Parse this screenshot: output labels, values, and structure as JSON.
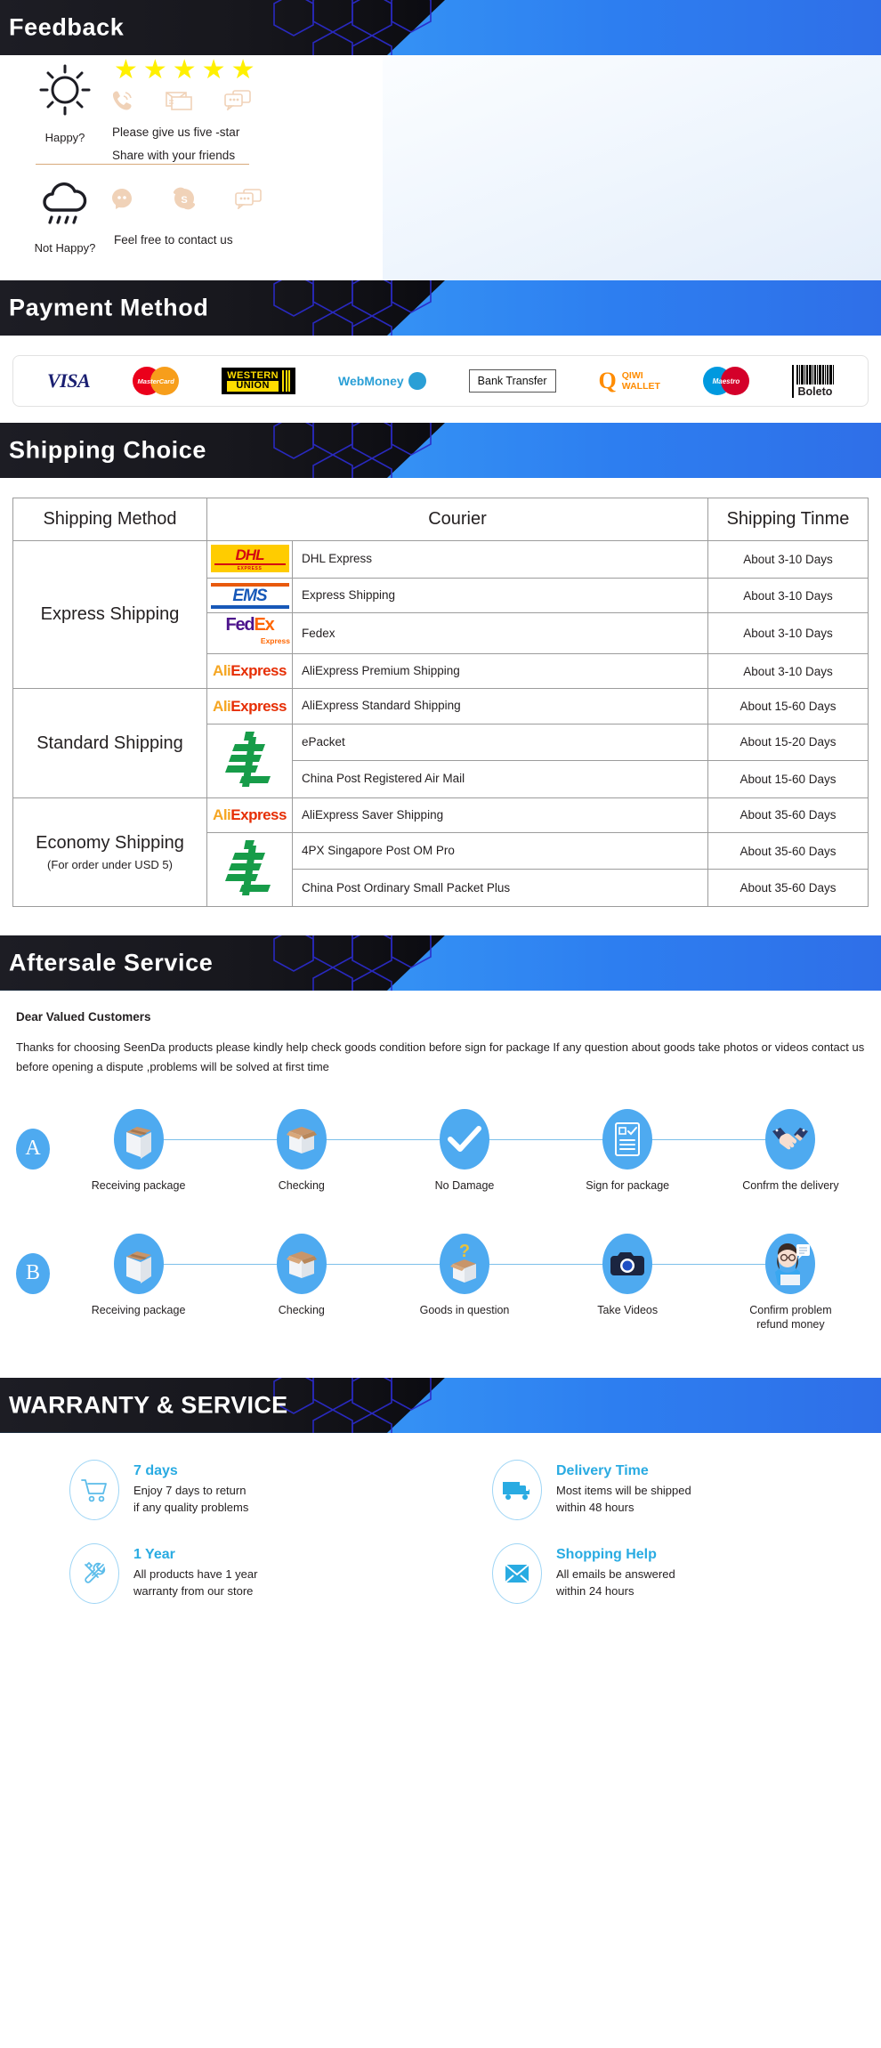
{
  "colors": {
    "accent_blue": "#29abe2",
    "banner_blue": "#2d7ef0",
    "banner_dark": "#17171d",
    "star_yellow": "#fff000",
    "flow_circle": "#4eaaf0",
    "divider_tan": "#d8a97a"
  },
  "feedback": {
    "banner_title": "Feedback",
    "happy_label": "Happy?",
    "stars": "★★★★★",
    "star_count": 5,
    "happy_line1": "Please give us five -star",
    "happy_line2": "Share  with your friends",
    "not_happy_label": "Not Happy?",
    "not_happy_text": "Feel free to contact us",
    "contact_icons": [
      "phone-icon",
      "envelope-icon",
      "chat-icon"
    ],
    "contact_icons_row2": [
      "facebook-messenger-icon",
      "skype-icon",
      "chat-icon"
    ]
  },
  "payment": {
    "banner_title": "Payment Method",
    "methods": [
      {
        "name": "visa-logo",
        "label": "VISA"
      },
      {
        "name": "mastercard-logo",
        "label": "MasterCard"
      },
      {
        "name": "western-union-logo",
        "label_top": "WESTERN",
        "label_bottom": "UNION"
      },
      {
        "name": "webmoney-logo",
        "label": "WebMoney"
      },
      {
        "name": "bank-transfer-logo",
        "label": "Bank Transfer"
      },
      {
        "name": "qiwi-wallet-logo",
        "label_top": "QIWI",
        "label_bottom": "WALLET",
        "mark": "Q"
      },
      {
        "name": "maestro-logo",
        "label": "Maestro"
      },
      {
        "name": "boleto-logo",
        "label": "Boleto"
      }
    ]
  },
  "shipping": {
    "banner_title": "Shipping Choice",
    "columns": [
      "Shipping Method",
      "Courier",
      "Shipping Tinme"
    ],
    "groups": [
      {
        "method": "Express Shipping",
        "note": "",
        "rows": [
          {
            "logo": "dhl-logo",
            "courier": "DHL Express",
            "time": "About 3-10 Days"
          },
          {
            "logo": "ems-logo",
            "courier": "Express Shipping",
            "time": "About 3-10 Days"
          },
          {
            "logo": "fedex-logo",
            "courier": "Fedex",
            "time": "About 3-10 Days"
          },
          {
            "logo": "aliexpress-logo",
            "courier": "AliExpress Premium Shipping",
            "time": "About 3-10 Days"
          }
        ]
      },
      {
        "method": "Standard Shipping",
        "note": "",
        "rows": [
          {
            "logo": "aliexpress-logo",
            "courier": "AliExpress Standard Shipping",
            "time": "About 15-60 Days"
          },
          {
            "logo": "china-post-logo",
            "courier": "ePacket",
            "time": "About 15-20 Days",
            "logo_span": 2
          },
          {
            "logo": "",
            "courier": "China Post Registered Air Mail",
            "time": "About 15-60 Days"
          }
        ]
      },
      {
        "method": "Economy Shipping",
        "note": "(For order under USD 5)",
        "rows": [
          {
            "logo": "aliexpress-logo",
            "courier": "AliExpress Saver Shipping",
            "time": "About 35-60 Days"
          },
          {
            "logo": "china-post-logo",
            "courier": "4PX Singapore Post OM Pro",
            "time": "About 35-60 Days",
            "logo_span": 2
          },
          {
            "logo": "",
            "courier": "China Post Ordinary Small Packet Plus",
            "time": "About 35-60 Days"
          }
        ]
      }
    ],
    "logo_text": {
      "dhl": "DHL",
      "dhl_sub": "EXPRESS",
      "ems": "EMS",
      "fedex_fed": "Fed",
      "fedex_ex": "Ex",
      "fedex_sub": "Express",
      "ali_a": "Ali",
      "ali_b": "Express"
    }
  },
  "aftersale": {
    "banner_title": "Aftersale Service",
    "greeting": "Dear Valued Customers",
    "body": "Thanks for choosing SeenDa products please kindly help check goods condition before sign for package If any question about goods take photos or videos contact us before opening a dispute ,problems will be solved at first time",
    "flows": [
      {
        "badge": "A",
        "steps": [
          {
            "icon": "closed-box-icon",
            "label": "Receiving package"
          },
          {
            "icon": "open-box-icon",
            "label": "Checking"
          },
          {
            "icon": "check-mark-icon",
            "label": "No Damage"
          },
          {
            "icon": "clipboard-check-icon",
            "label": "Sign for package"
          },
          {
            "icon": "handshake-icon",
            "label": "Confrm the delivery"
          }
        ]
      },
      {
        "badge": "B",
        "steps": [
          {
            "icon": "closed-box-icon",
            "label": "Receiving package"
          },
          {
            "icon": "open-box-icon",
            "label": "Checking"
          },
          {
            "icon": "question-box-icon",
            "label": "Goods in question"
          },
          {
            "icon": "camera-icon",
            "label": "Take Videos"
          },
          {
            "icon": "support-agent-icon",
            "label": "Confirm problem\nrefund money"
          }
        ]
      }
    ]
  },
  "warranty": {
    "banner_title": "WARRANTY & SERVICE",
    "cards": [
      {
        "icon": "shopping-cart-icon",
        "title": "7 days",
        "line1": "Enjoy 7 days to return",
        "line2": "if any quality problems"
      },
      {
        "icon": "delivery-truck-icon",
        "title": "Delivery Time",
        "line1": "Most items will be shipped",
        "line2": "within 48 hours"
      },
      {
        "icon": "tools-icon",
        "title": "1 Year",
        "line1": "All products have 1 year",
        "line2": "warranty from our store"
      },
      {
        "icon": "envelope-icon",
        "title": "Shopping Help",
        "line1": "All emails be answered",
        "line2": "within 24 hours"
      }
    ]
  }
}
